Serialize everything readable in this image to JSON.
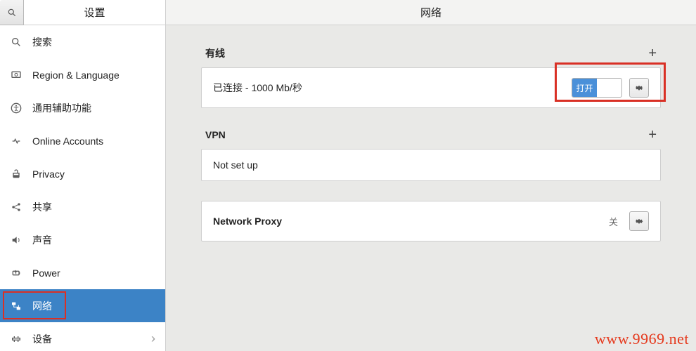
{
  "sidebar": {
    "title": "设置",
    "items": [
      {
        "label": "搜索",
        "icon": "search-icon"
      },
      {
        "label": "Region & Language",
        "icon": "globe-icon"
      },
      {
        "label": "通用辅助功能",
        "icon": "accessibility-icon"
      },
      {
        "label": "Online Accounts",
        "icon": "accounts-icon"
      },
      {
        "label": "Privacy",
        "icon": "privacy-icon"
      },
      {
        "label": "共享",
        "icon": "share-icon"
      },
      {
        "label": "声音",
        "icon": "sound-icon"
      },
      {
        "label": "Power",
        "icon": "power-icon"
      },
      {
        "label": "网络",
        "icon": "network-icon"
      },
      {
        "label": "设备",
        "icon": "devices-icon",
        "chevron": true
      }
    ],
    "selected_index": 8
  },
  "content": {
    "title": "网络",
    "sections": {
      "wired": {
        "header": "有线",
        "status": "已连接 - 1000 Mb/秒",
        "switch_label": "打开"
      },
      "vpn": {
        "header": "VPN",
        "status": "Not set up"
      },
      "proxy": {
        "header": "Network Proxy",
        "status": "关"
      }
    }
  },
  "watermark": "www.9969.net"
}
